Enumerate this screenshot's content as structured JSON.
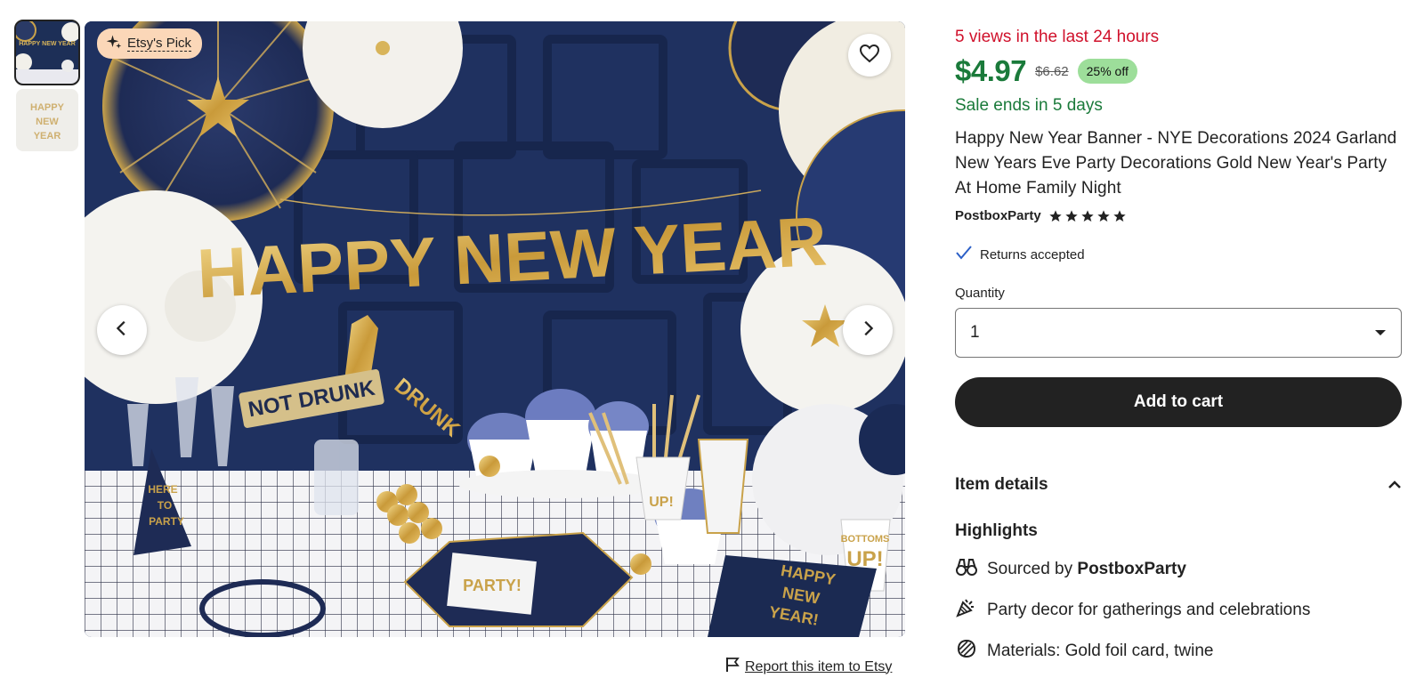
{
  "gallery": {
    "thumbnails": [
      {
        "label": "HAPPY NEW YEAR",
        "active": true
      },
      {
        "label": "HAPPY NEW YEAR",
        "active": false
      }
    ],
    "badge_label": "Etsy's Pick",
    "banner_text": "HAPPY NEW YEAR",
    "props": {
      "sign_not_drunk": "NOT DRUNK",
      "sign_drunk": "DRUNK",
      "plate": "PARTY!",
      "napkin_line1": "HAPPY",
      "napkin_line2": "NEW",
      "napkin_line3": "YEAR!",
      "cup_line1": "BOTTOMS",
      "cup_line2": "UP!",
      "hat_line1": "HERE",
      "hat_line2": "TO",
      "hat_line3": "PARTY",
      "small_cup": "UP!"
    }
  },
  "report_link": "Report this item to Etsy",
  "listing": {
    "views_text": "5 views in the last 24 hours",
    "price": "$4.97",
    "original_price": "$6.62",
    "discount": "25% off",
    "sale_ends": "Sale ends in 5 days",
    "title": "Happy New Year Banner - NYE Decorations 2024 Garland New Years Eve Party Decorations Gold New Year's Party At Home Family Night",
    "shop_name": "PostboxParty",
    "rating_stars": 5,
    "returns": "Returns accepted",
    "quantity_label": "Quantity",
    "quantity_value": "1",
    "add_to_cart": "Add to cart",
    "item_details": "Item details",
    "highlights_title": "Highlights",
    "highlights": [
      {
        "icon": "binoculars-icon",
        "prefix": "Sourced by ",
        "strong": "PostboxParty"
      },
      {
        "icon": "party-horn-icon",
        "prefix": "Party decor for gatherings and celebrations",
        "strong": ""
      },
      {
        "icon": "materials-icon",
        "prefix": "Materials: Gold foil card, twine",
        "strong": ""
      }
    ]
  },
  "colors": {
    "views": "#d0112b",
    "price": "#1a7a3a",
    "discount_bg": "#9dde9a",
    "badge_bg": "#fbd7b8",
    "button_bg": "#222222"
  }
}
